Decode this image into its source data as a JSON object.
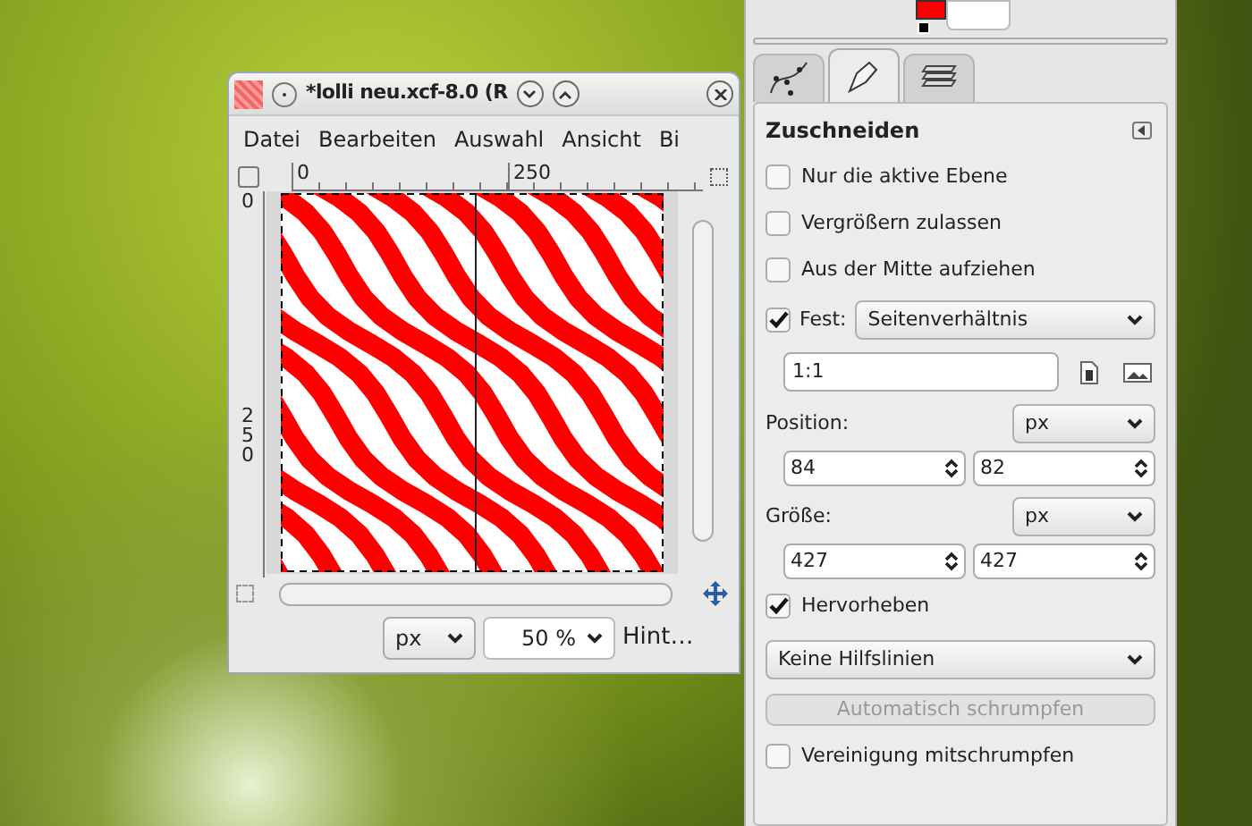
{
  "image_window": {
    "title": "*lolli neu.xcf-8.0 (R",
    "menu": [
      "Datei",
      "Bearbeiten",
      "Auswahl",
      "Ansicht",
      "Bi"
    ],
    "h_ruler": [
      "0",
      "250"
    ],
    "v_ruler": [
      "0",
      "250"
    ],
    "unit": "px",
    "zoom": "50 %",
    "status": "Hint…"
  },
  "tool_options": {
    "tabs": [
      {
        "selected": false
      },
      {
        "selected": true
      },
      {
        "selected": false
      }
    ],
    "title": "Zuschneiden",
    "rows": [
      {
        "kind": "checkbox",
        "label": "Nur die aktive Ebene",
        "checked": false
      },
      {
        "kind": "checkbox",
        "label": "Vergrößern zulassen",
        "checked": false
      },
      {
        "kind": "checkbox",
        "label": "Aus der Mitte aufziehen",
        "checked": false
      },
      {
        "kind": "fixed",
        "label": "Fest:",
        "checked": true,
        "value": "Seitenverhältnis"
      },
      {
        "kind": "ratio",
        "value": "1:1"
      },
      {
        "kind": "unit",
        "label": "Position:",
        "unit": "px"
      },
      {
        "kind": "pair",
        "values": [
          "84",
          "82"
        ]
      },
      {
        "kind": "unit",
        "label": "Größe:",
        "unit": "px"
      },
      {
        "kind": "pair",
        "values": [
          "427",
          "427"
        ]
      },
      {
        "kind": "checkbox",
        "label": "Hervorheben",
        "checked": true
      },
      {
        "kind": "dropdown",
        "value": "Keine Hilfslinien"
      },
      {
        "kind": "button",
        "label": "Automatisch schrumpfen",
        "disabled": true
      },
      {
        "kind": "checkbox",
        "label": "Vereinigung mitschrumpfen",
        "checked": false
      }
    ]
  }
}
